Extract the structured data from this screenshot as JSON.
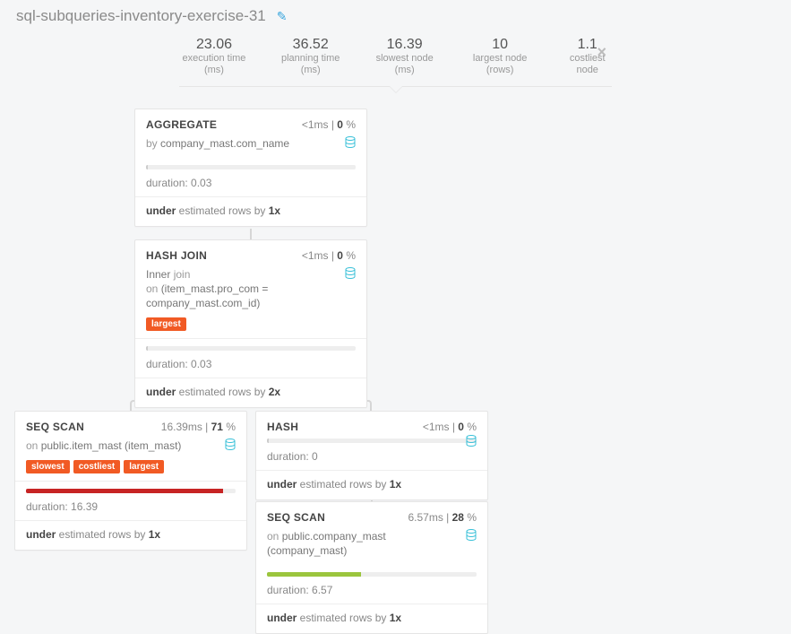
{
  "page": {
    "title": "sql-subqueries-inventory-exercise-31"
  },
  "stats": {
    "execution_time": {
      "value": "23.06",
      "label": "execution time (ms)"
    },
    "planning_time": {
      "value": "36.52",
      "label": "planning time (ms)"
    },
    "slowest_node": {
      "value": "16.39",
      "label": "slowest node (ms)"
    },
    "largest_node": {
      "value": "10",
      "label": "largest node (rows)"
    },
    "costliest_node": {
      "value": "1.1",
      "label": "costliest node"
    }
  },
  "nodes": {
    "aggregate": {
      "title": "AGGREGATE",
      "time": "<1ms",
      "pct": "0",
      "sub_prefix": "by ",
      "sub_detail": "company_mast.com_name",
      "duration_label": "duration: 0.03",
      "est_prefix": "under",
      "est_mid": " estimated rows by ",
      "est_factor": "1x",
      "progress": 1
    },
    "hashjoin": {
      "title": "HASH JOIN",
      "time": "<1ms",
      "pct": "0",
      "sub_line1a": "Inner ",
      "sub_line1b": "join",
      "sub_line2a": "on ",
      "sub_line2b": "(item_mast.pro_com = company_mast.com_id)",
      "badge": "largest",
      "duration_label": "duration: 0.03",
      "est_prefix": "under",
      "est_mid": " estimated rows by ",
      "est_factor": "2x",
      "progress": 1
    },
    "seqscan1": {
      "title": "SEQ SCAN",
      "time": "16.39ms",
      "pct": "71",
      "sub_prefix": "on ",
      "sub_detail": "public.item_mast (item_mast)",
      "badge1": "slowest",
      "badge2": "costliest",
      "badge3": "largest",
      "duration_label": "duration: 16.39",
      "est_prefix": "under",
      "est_mid": " estimated rows by ",
      "est_factor": "1x",
      "progress": 94
    },
    "hash": {
      "title": "HASH",
      "time": "<1ms",
      "pct": "0",
      "duration_label": "duration: 0",
      "est_prefix": "under",
      "est_mid": " estimated rows by ",
      "est_factor": "1x",
      "progress": 1
    },
    "seqscan2": {
      "title": "SEQ SCAN",
      "time": "6.57ms",
      "pct": "28",
      "sub_prefix": "on ",
      "sub_detail": "public.company_mast (company_mast)",
      "duration_label": "duration: 6.57",
      "est_prefix": "under",
      "est_mid": " estimated rows by ",
      "est_factor": "1x",
      "progress": 45
    }
  },
  "labels": {
    "sep": " | ",
    "pct_suffix": " %"
  }
}
